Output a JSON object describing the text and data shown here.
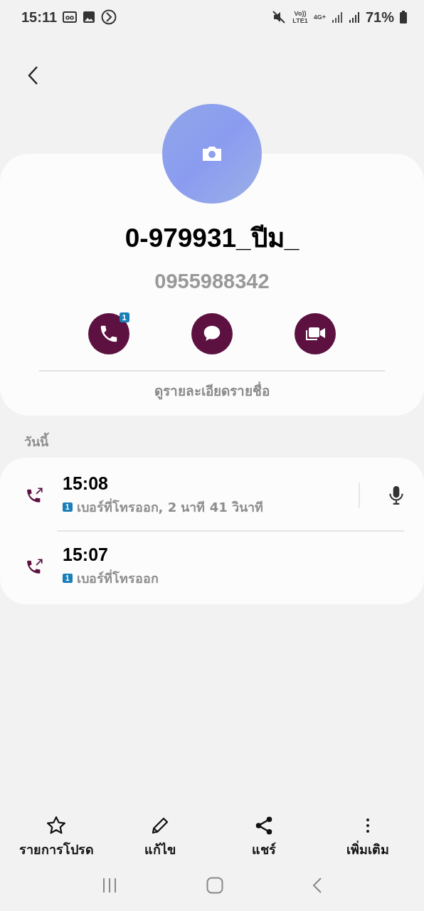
{
  "status_bar": {
    "time": "15:11",
    "volte": "Vo))",
    "lte": "LTE1",
    "network": "4G+",
    "battery": "71%"
  },
  "contact": {
    "name": "0-979931_ปีม_",
    "number": "0955988342",
    "call_badge": "1",
    "details_link": "ดูรายละเอียดรายชื่อ"
  },
  "history": {
    "section": "วันนี้",
    "calls": [
      {
        "time": "15:08",
        "sim": "1",
        "description": "เบอร์ที่โทรออก, 2 นาที 41 วินาที",
        "recording": true
      },
      {
        "time": "15:07",
        "sim": "1",
        "description": "เบอร์ที่โทรออก",
        "recording": false
      }
    ]
  },
  "toolbar": [
    {
      "kind": "star",
      "label": "รายการโปรด"
    },
    {
      "kind": "edit",
      "label": "แก้ไข"
    },
    {
      "kind": "share",
      "label": "แชร์"
    },
    {
      "kind": "more",
      "label": "เพิ่มเติม"
    }
  ]
}
